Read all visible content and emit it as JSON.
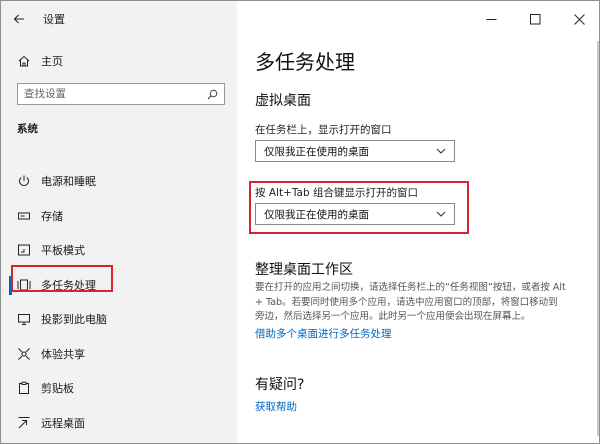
{
  "window": {
    "app_title": "设置"
  },
  "sidebar": {
    "home_label": "主页",
    "search_placeholder": "查找设置",
    "section_label": "系统",
    "items": [
      {
        "label": "电源和睡眠",
        "icon": "power-icon"
      },
      {
        "label": "存储",
        "icon": "storage-icon"
      },
      {
        "label": "平板模式",
        "icon": "tablet-mode-icon"
      },
      {
        "label": "多任务处理",
        "icon": "multitasking-icon",
        "selected": true
      },
      {
        "label": "投影到此电脑",
        "icon": "project-icon"
      },
      {
        "label": "体验共享",
        "icon": "shared-experiences-icon"
      },
      {
        "label": "剪贴板",
        "icon": "clipboard-icon"
      },
      {
        "label": "远程桌面",
        "icon": "remote-desktop-icon"
      }
    ]
  },
  "main": {
    "title": "多任务处理",
    "virtual_desktops": {
      "heading": "虚拟桌面",
      "taskbar_label": "在任务栏上，显示打开的窗口",
      "taskbar_value": "仅限我正在使用的桌面",
      "alttab_label": "按 Alt+Tab 组合键显示打开的窗口",
      "alttab_value": "仅限我正在使用的桌面"
    },
    "organize": {
      "heading": "整理桌面工作区",
      "desc_line1": "要在打开的应用之间切换，请选择任务栏上的“任务视图”按钮，或者按 Alt",
      "desc_line2": "+ Tab。若要同时使用多个应用，请选中应用窗口的顶部，将窗口移动到",
      "desc_line3": "旁边，然后选择另一个应用。此时另一个应用便会出现在屏幕上。",
      "link": "借助多个桌面进行多任务处理"
    },
    "questions": {
      "heading": "有疑问?",
      "link": "获取帮助"
    }
  },
  "colors": {
    "accent": "#0067c0",
    "highlight": "#d9252a",
    "sidebar_bg": "#f2f2f2"
  }
}
